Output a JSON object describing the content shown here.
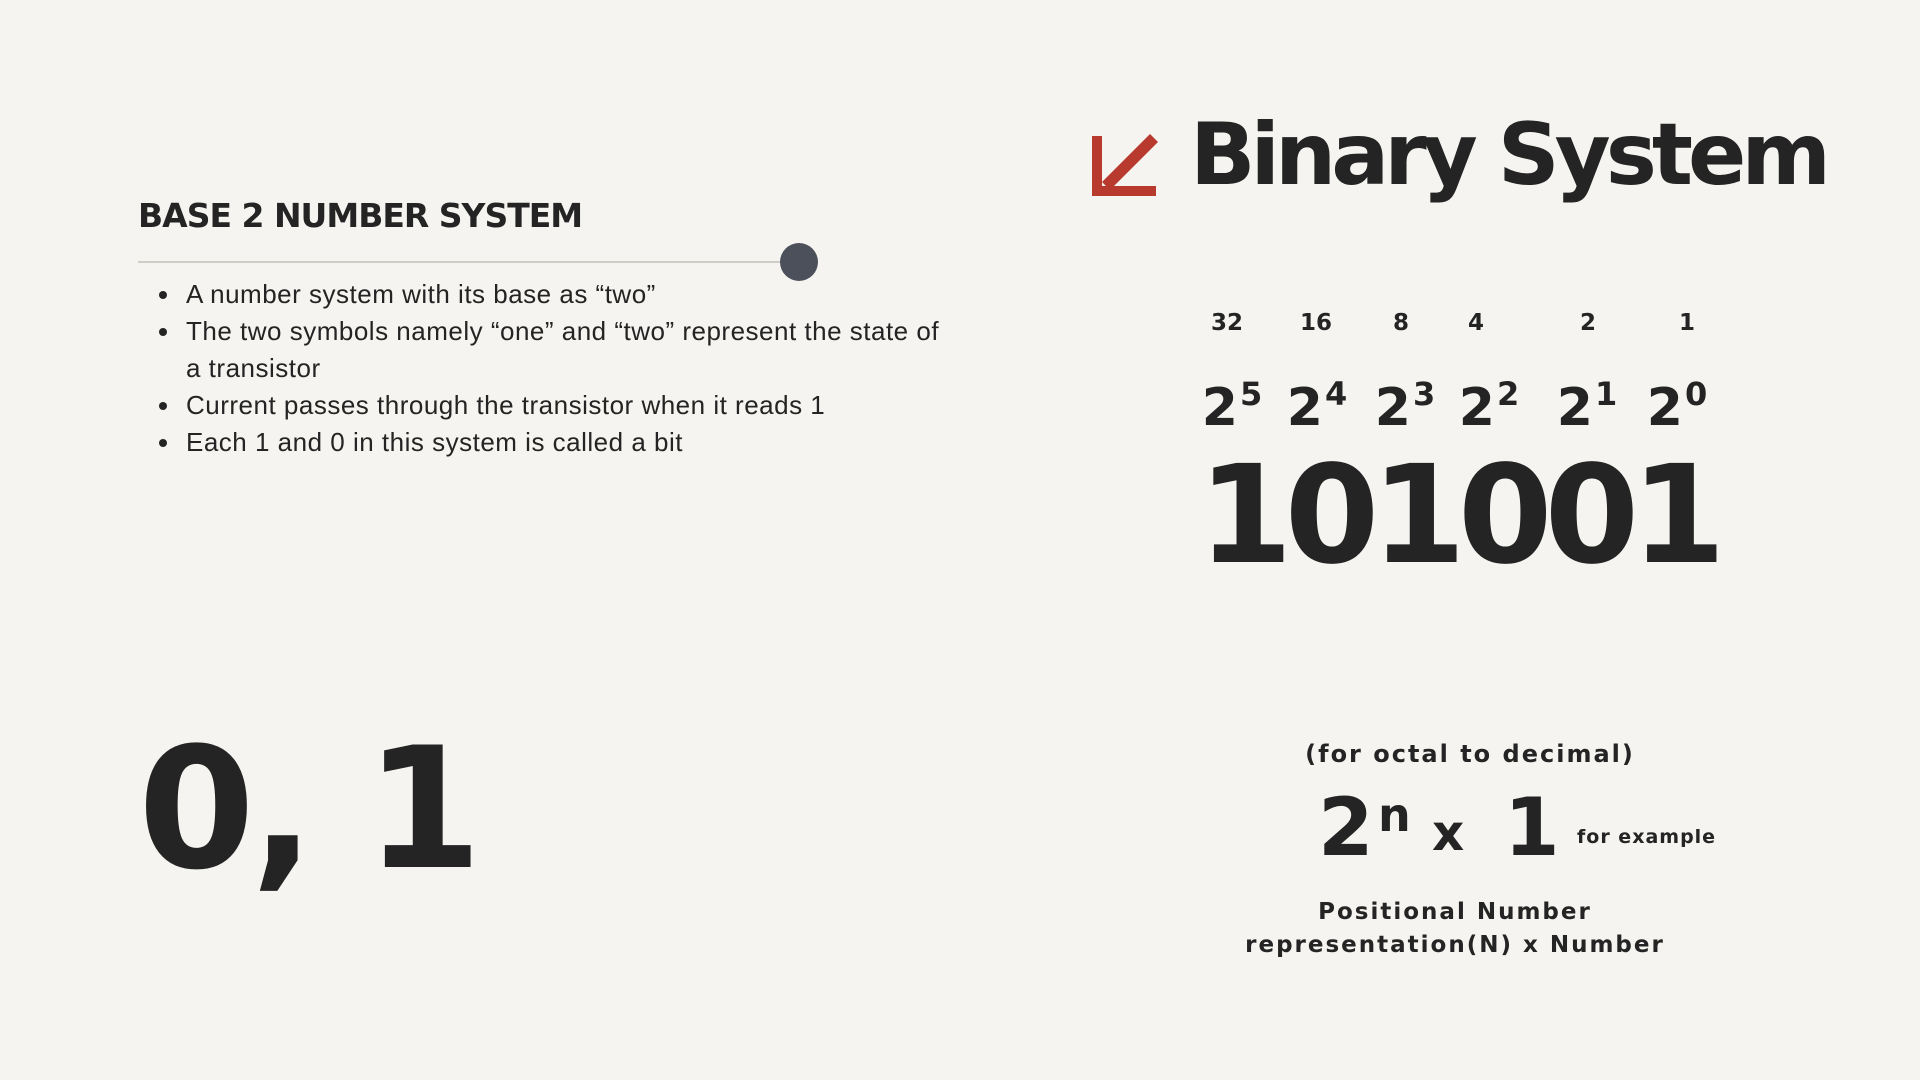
{
  "section": {
    "heading": "BASE 2 NUMBER SYSTEM",
    "bullets": [
      "A number system with its base as “two”",
      "The two symbols namely “one” and “two” represent the state of a transistor",
      "Current passes through the transistor when it reads 1",
      "Each 1 and 0 in this system is called a bit"
    ],
    "digits": "0, 1"
  },
  "title": {
    "text": "Binary System",
    "icon": "arrow-down-left-icon",
    "icon_color": "#b83a2f"
  },
  "place_values": {
    "values": [
      "32",
      "16",
      "8",
      "4",
      "2",
      "1"
    ],
    "base": "2",
    "exponents": [
      "5",
      "4",
      "3",
      "2",
      "1",
      "0"
    ],
    "binary_number": "101001"
  },
  "formula": {
    "caption": "(for octal to decimal)",
    "base": "2",
    "exponent": "n",
    "operator": "x",
    "number": "1",
    "note": "for example",
    "description": [
      "Positional Number",
      "representation(N) x Number"
    ]
  },
  "colors": {
    "background": "#f5f4f0",
    "text": "#242424",
    "accent": "#b83a2f",
    "dot": "#4b505a"
  }
}
